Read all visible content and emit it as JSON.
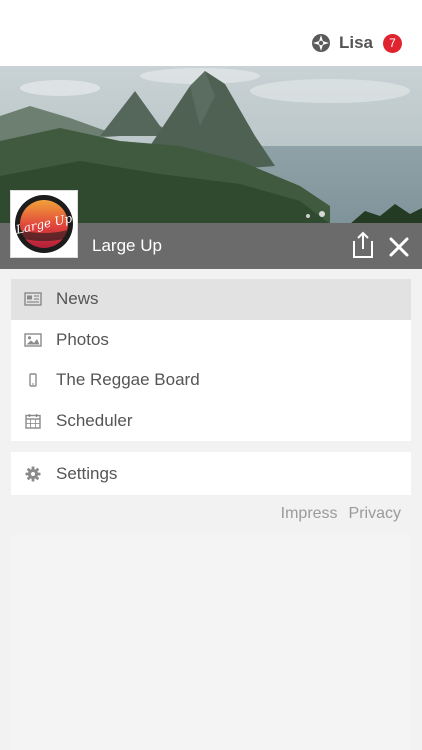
{
  "header": {
    "user_name": "Lisa",
    "notification_count": "7",
    "badge_color": "#e0242f"
  },
  "app": {
    "title": "Large Up",
    "logo_text": "Large Up"
  },
  "menu": {
    "items": [
      {
        "label": "News",
        "icon": "newspaper-icon",
        "active": true
      },
      {
        "label": "Photos",
        "icon": "image-icon",
        "active": false
      },
      {
        "label": "The Reggae Board",
        "icon": "phone-icon",
        "active": false
      },
      {
        "label": "Scheduler",
        "icon": "calendar-icon",
        "active": false
      }
    ],
    "settings": {
      "label": "Settings",
      "icon": "gear-icon"
    }
  },
  "footer": {
    "impress": "Impress",
    "privacy": "Privacy"
  }
}
